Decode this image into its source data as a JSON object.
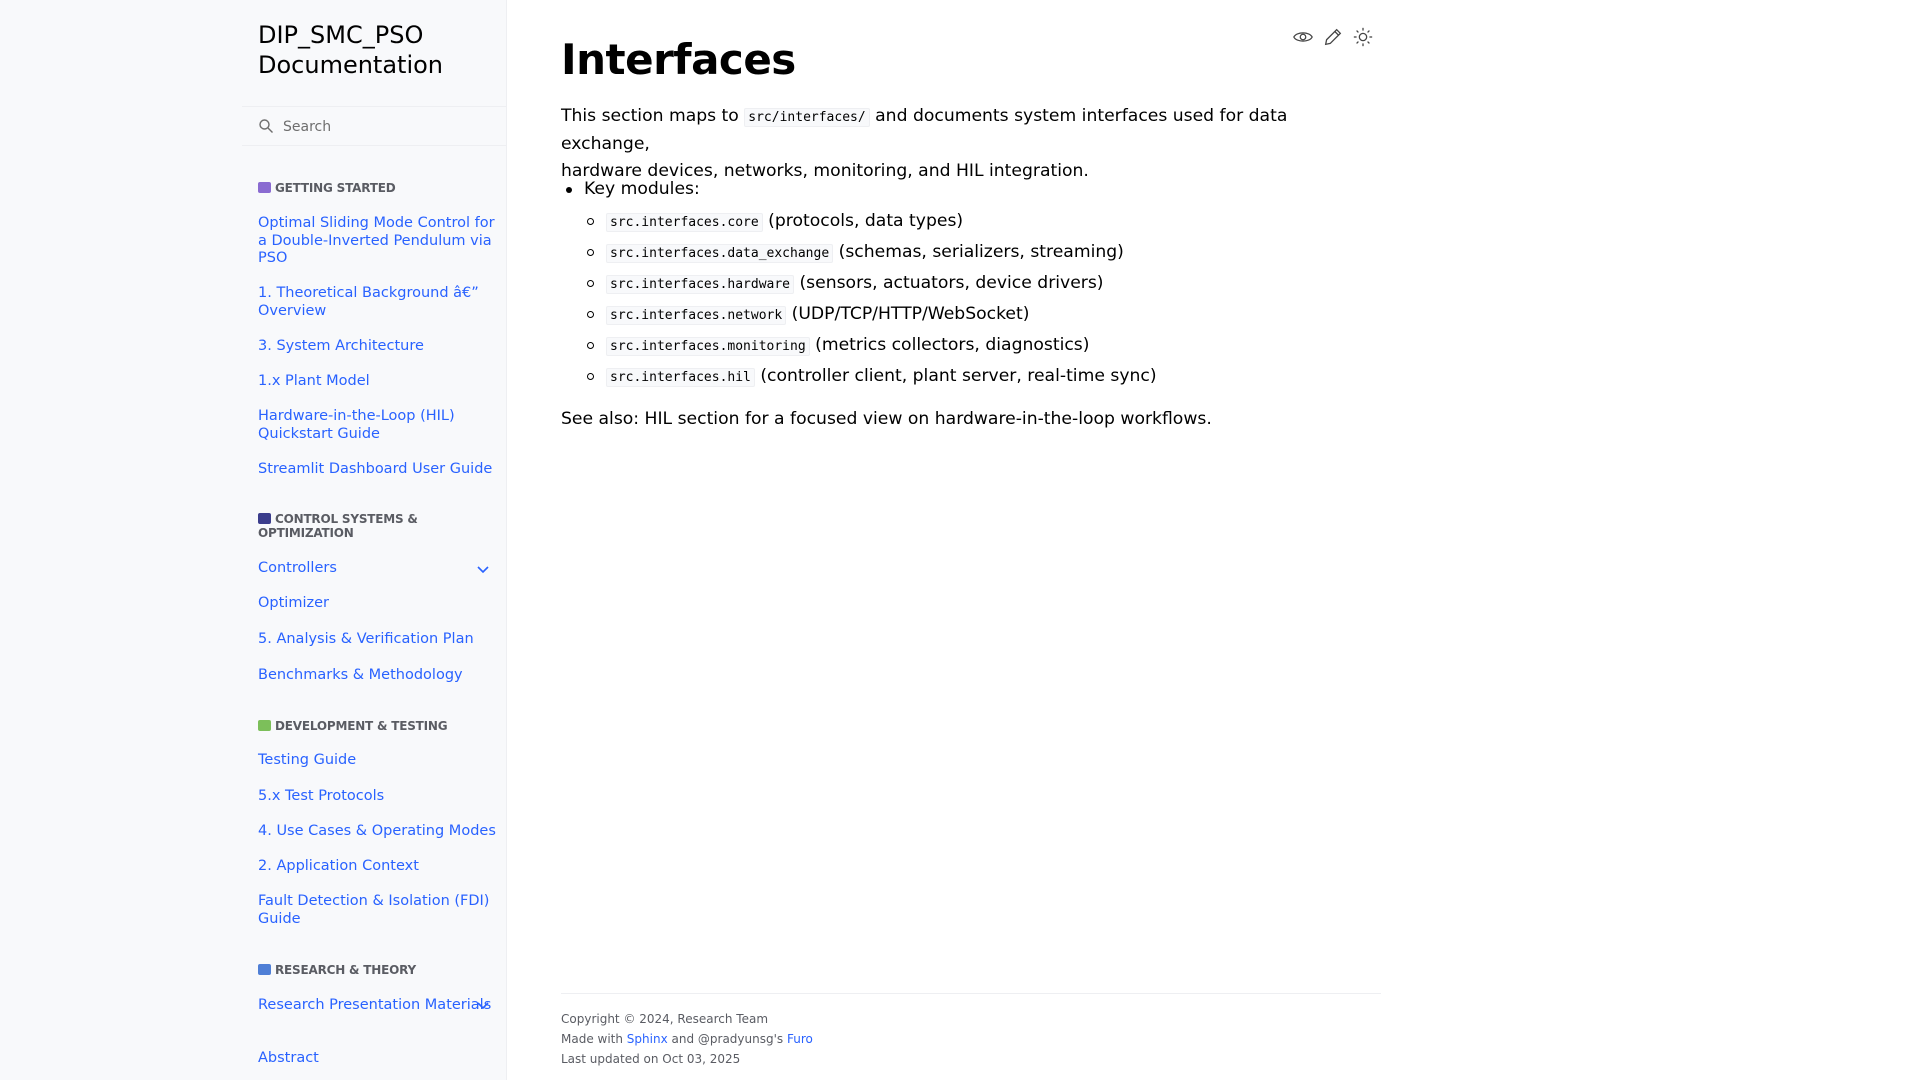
{
  "sidebar": {
    "brand_line1": "DIP_SMC_PSO",
    "brand_line2": "Documentation",
    "search_placeholder": "Search",
    "sections": [
      {
        "caption": "GETTING STARTED",
        "emoji_color": "#8a6bd1",
        "items": [
          "Optimal Sliding Mode Control for a Double-Inverted Pendulum via PSO",
          "1. Theoretical Background â€” Overview",
          "3. System Architecture",
          "1.x Plant Model",
          "Hardware-in-the-Loop (HIL) Quickstart Guide",
          "Streamlit Dashboard User Guide"
        ]
      },
      {
        "caption": "CONTROL SYSTEMS & OPTIMIZATION",
        "emoji_color": "#3b3d8c",
        "items": [
          "Controllers",
          "Optimizer",
          "5. Analysis & Verification Plan",
          "Benchmarks & Methodology"
        ]
      },
      {
        "caption": "DEVELOPMENT & TESTING",
        "emoji_color": "#7cbf5a",
        "items": [
          "Testing Guide",
          "5.x Test Protocols",
          "4. Use Cases & Operating Modes",
          "2. Application Context",
          "Fault Detection & Isolation (FDI) Guide"
        ]
      },
      {
        "caption": "RESEARCH & THEORY",
        "emoji_color": "#4f7fd6",
        "items": [
          "Research Presentation Materials",
          "Abstract"
        ]
      }
    ]
  },
  "actions": {
    "view_source": "view-source-icon",
    "edit": "edit-icon",
    "theme": "theme-toggle-icon"
  },
  "main": {
    "title": "Interfaces",
    "intro_a": "This section maps to ",
    "intro_code": "src/interfaces/",
    "intro_b": " and documents system interfaces used for data exchange,",
    "intro_c": "hardware devices, networks, monitoring, and HIL integration.",
    "key_modules_label": "Key modules:",
    "modules": [
      {
        "code": "src.interfaces.core",
        "desc": " (protocols, data types)"
      },
      {
        "code": "src.interfaces.data_exchange",
        "desc": " (schemas, serializers, streaming)"
      },
      {
        "code": "src.interfaces.hardware",
        "desc": " (sensors, actuators, device drivers)"
      },
      {
        "code": "src.interfaces.network",
        "desc": " (UDP/TCP/HTTP/WebSocket)"
      },
      {
        "code": "src.interfaces.monitoring",
        "desc": " (metrics collectors, diagnostics)"
      },
      {
        "code": "src.interfaces.hil",
        "desc": " (controller client, plant server, real-time sync)"
      }
    ],
    "see_also": "See also: HIL section for a focused view on hardware-in-the-loop workflows."
  },
  "footer": {
    "copyright": "Copyright © 2024, Research Team",
    "made_with": "Made with ",
    "sphinx": "Sphinx",
    "and_by": " and @pradyunsg's ",
    "furo": "Furo",
    "updated": "Last updated on Oct 03, 2025"
  },
  "colors": {
    "link": "#2962ff",
    "sidebar_bg": "#f8f9fb"
  }
}
